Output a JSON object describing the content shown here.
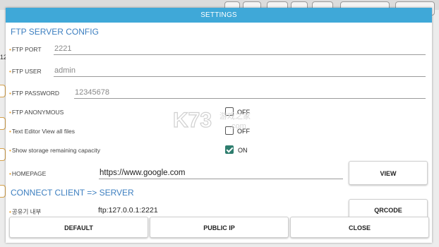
{
  "dialog": {
    "title": "SETTINGS"
  },
  "ftp_server_config": {
    "section_title": "FTP SERVER CONFIG",
    "port": {
      "label": "FTP PORT",
      "value": "2221"
    },
    "user": {
      "label": "FTP USER",
      "value": "admin"
    },
    "password": {
      "label": "FTP PASSWORD",
      "value": "12345678"
    },
    "anonymous": {
      "label": "FTP ANONYMOUS",
      "state": "OFF",
      "checked": false
    },
    "text_editor": {
      "label": "Text Editor View all files",
      "state": "OFF",
      "checked": false
    },
    "storage": {
      "label": "Show storage remaining capacity",
      "state": "ON",
      "checked": true
    },
    "homepage": {
      "label": "HOMEPAGE",
      "value": "https://www.google.com",
      "button": "VIEW"
    }
  },
  "connect_client": {
    "section_title": "CONNECT CLIENT => SERVER",
    "internal": {
      "label": "공유기 내부",
      "value": "ftp:127.0.0.1:2221",
      "button": "QRCODE"
    }
  },
  "footer": {
    "default_label": "DEFAULT",
    "public_ip_label": "PUBLIC IP",
    "close_label": "CLOSE"
  },
  "background": {
    "side_text": "12"
  },
  "watermark": {
    "logo_text": "K73",
    "sub_text": "游戏之家",
    "domain": ".com"
  },
  "colors": {
    "title_bar": "#3fa8d8",
    "section_title": "#3d7fc0",
    "bullet": "#e39b2a",
    "checkbox_on": "#2e7d6e"
  }
}
